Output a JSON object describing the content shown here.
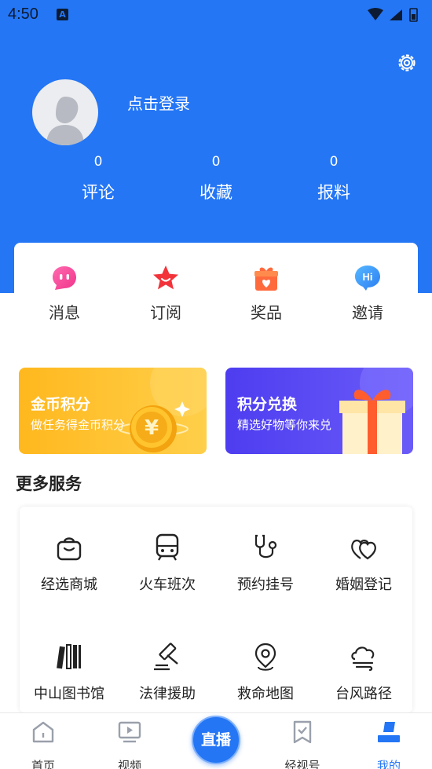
{
  "status_bar": {
    "time": "4:50",
    "notif_letter": "A"
  },
  "profile": {
    "login_label": "点击登录",
    "stats": [
      {
        "value": "0",
        "label": "评论"
      },
      {
        "value": "0",
        "label": "收藏"
      },
      {
        "value": "0",
        "label": "报料"
      }
    ]
  },
  "quick_actions": [
    {
      "label": "消息",
      "icon": "message-icon"
    },
    {
      "label": "订阅",
      "icon": "star-icon"
    },
    {
      "label": "奖品",
      "icon": "gift-icon"
    },
    {
      "label": "邀请",
      "icon": "hi-bubble-icon"
    }
  ],
  "promos": {
    "coins": {
      "title": "金币积分",
      "subtitle": "做任务得金币积分",
      "symbol": "¥"
    },
    "exchange": {
      "title": "积分兑换",
      "subtitle": "精选好物等你来兑"
    }
  },
  "more_services": {
    "title": "更多服务",
    "items": [
      {
        "label": "经选商城",
        "icon": "shopping-bag-icon"
      },
      {
        "label": "火车班次",
        "icon": "train-icon"
      },
      {
        "label": "预约挂号",
        "icon": "stethoscope-icon"
      },
      {
        "label": "婚姻登记",
        "icon": "double-heart-icon"
      },
      {
        "label": "中山图书馆",
        "icon": "books-icon"
      },
      {
        "label": "法律援助",
        "icon": "gavel-icon"
      },
      {
        "label": "救命地图",
        "icon": "map-pin-icon"
      },
      {
        "label": "台风路径",
        "icon": "typhoon-cloud-icon"
      }
    ]
  },
  "tabbar": {
    "tabs": [
      {
        "label": "首页",
        "icon": "home-icon"
      },
      {
        "label": "视频",
        "icon": "video-icon"
      },
      {
        "label": "经视号",
        "icon": "bookmark-check-icon"
      },
      {
        "label": "我的",
        "icon": "profile-tab-icon"
      }
    ],
    "live_label": "直播",
    "active_color": "#2476f5"
  },
  "colors": {
    "brand_blue": "#2476f5",
    "gold": "#ffb81e",
    "purple": "#4d3df0"
  }
}
